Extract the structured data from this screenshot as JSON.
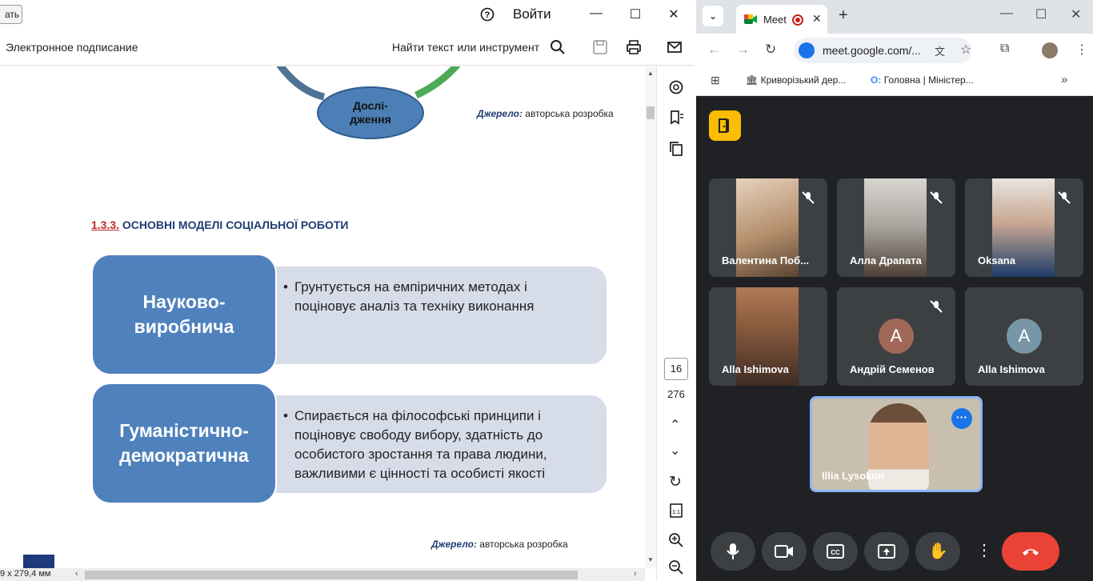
{
  "pdf": {
    "top_button": "ать",
    "signin": "Войти",
    "toolbar": {
      "esign": "Электронное подписание",
      "find": "Найти текст или инструмент"
    },
    "slide": {
      "circle_label": "Дослі-\nдження",
      "source_label": "Джерело:",
      "source_text": " авторська розробка",
      "heading_num": "1.3.3.",
      "heading_text": " ОСНОВНІ МОДЕЛІ СОЦІАЛЬНОЇ РОБОТИ",
      "models": [
        {
          "name": "Науково-\nвиробнича",
          "desc": "Грунтується на емпіричних методах і поціновує аналіз та техніку виконання"
        },
        {
          "name": "Гуманістично-\nдемократична",
          "desc": "Спирається на філософські принципи і поціновує свободу вибору, здатність до особистого зростання та права людини, важливими є цінності та особисті якості"
        }
      ]
    },
    "page_current": "16",
    "page_total": "276",
    "dims": "9 x 279,4 мм"
  },
  "chrome": {
    "tab_title": "Meet",
    "url": "meet.google.com/...",
    "bookmarks": [
      "Криворізький дер...",
      "Головна | Міністер..."
    ]
  },
  "meet": {
    "participants": [
      {
        "name": "Валентина Поб...",
        "muted": true,
        "video": true
      },
      {
        "name": "Алла Драпата",
        "muted": true,
        "video": true
      },
      {
        "name": "Oksana",
        "muted": true,
        "video": true
      },
      {
        "name": "Alla Ishimova",
        "muted": false,
        "video": true
      },
      {
        "name": "Андрій Семенов",
        "muted": true,
        "video": false,
        "initial": "A",
        "color": "#a1685a"
      },
      {
        "name": "Alla Ishimova",
        "muted": false,
        "video": false,
        "initial": "A",
        "color": "#7896a8"
      }
    ],
    "self_name": "Illia Lysokon"
  },
  "colors": {
    "accent_blue": "#4f81bd",
    "end_call": "#ea4335",
    "meet_bg": "#202124"
  }
}
